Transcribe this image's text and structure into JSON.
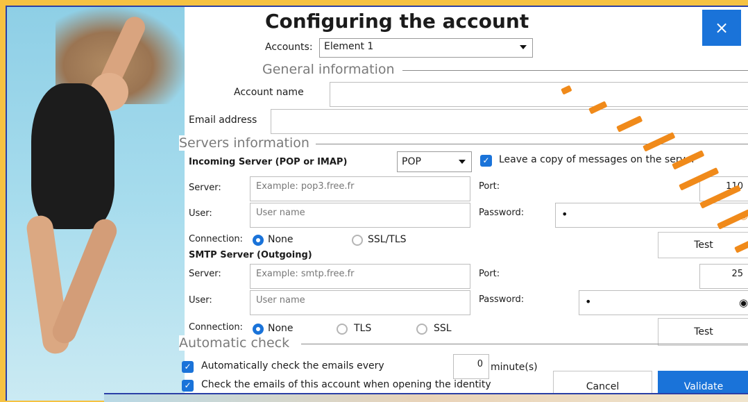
{
  "dialog": {
    "title": "Configuring the account",
    "close_label": "×",
    "accounts_label": "Accounts:",
    "accounts_value": "Element 1"
  },
  "general": {
    "section_title": "General information",
    "account_name_label": "Account name",
    "account_name_value": "",
    "email_label": "Email address",
    "email_value": ""
  },
  "servers": {
    "section_title": "Servers information",
    "incoming": {
      "heading": "Incoming Server (POP or IMAP)",
      "protocol_value": "POP",
      "leave_copy_label": "Leave a copy of messages on the server",
      "leave_copy_checked": true,
      "server_label": "Server:",
      "server_placeholder": "Example: pop3.free.fr",
      "port_label": "Port:",
      "port_value": "110",
      "user_label": "User:",
      "user_placeholder": "User name",
      "password_label": "Password:",
      "password_value": "•",
      "connection_label": "Connection:",
      "connection_options": [
        "None",
        "SSL/TLS"
      ],
      "connection_selected": "None",
      "test_label": "Test"
    },
    "smtp": {
      "heading": "SMTP Server (Outgoing)",
      "server_label": "Server:",
      "server_placeholder": "Example: smtp.free.fr",
      "port_label": "Port:",
      "port_value": "25",
      "user_label": "User:",
      "user_placeholder": "User name",
      "password_label": "Password:",
      "password_value": "•",
      "connection_label": "Connection:",
      "connection_options": [
        "None",
        "TLS",
        "SSL"
      ],
      "connection_selected": "None",
      "test_label": "Test"
    }
  },
  "auto_check": {
    "section_title": "Automatic check",
    "check_every_label": "Automatically check the emails every",
    "check_every_checked": true,
    "interval_value": "0",
    "interval_unit": "minute(s)",
    "on_open_label": "Check the emails of this account when opening the identity",
    "on_open_checked": true
  },
  "actions": {
    "cancel_label": "Cancel",
    "validate_label": "Validate"
  },
  "colors": {
    "accent": "#1a73d9",
    "background": "#f6c242",
    "stripe": "#f08a1a"
  },
  "icons": {
    "close": "close-icon",
    "password_reveal": "eye-icon",
    "checkbox": "checkmark-icon",
    "dropdown": "chevron-down-icon"
  }
}
